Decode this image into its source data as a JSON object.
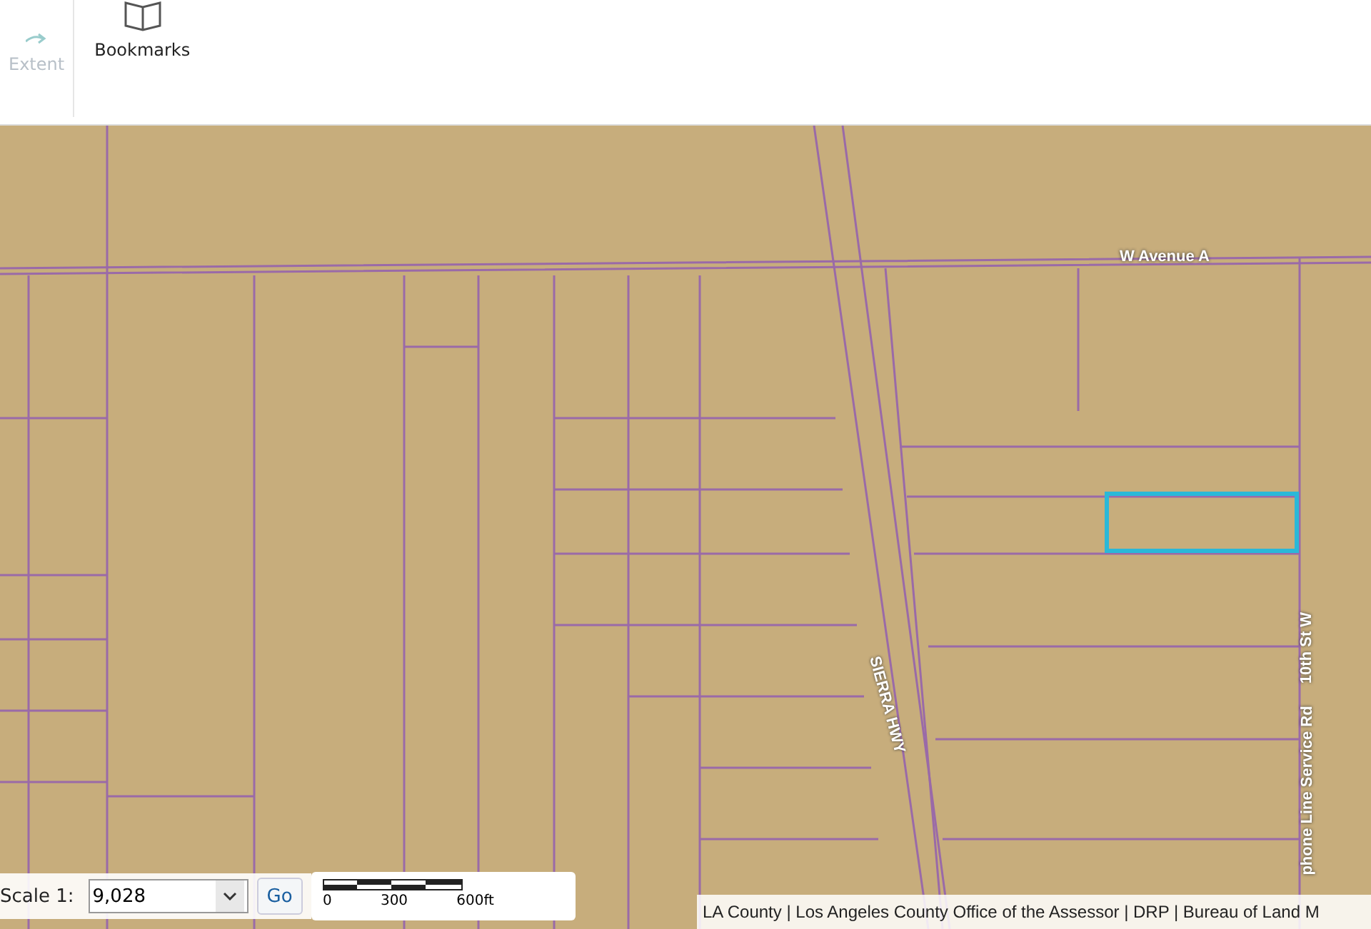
{
  "toolbar": {
    "items": [
      {
        "label": "Extent",
        "disabled": true
      },
      {
        "label": "Bookmarks",
        "disabled": false
      }
    ]
  },
  "map": {
    "street_labels": [
      {
        "text": "W Avenue A",
        "kind": "horizontal"
      },
      {
        "text": "SIERRA HWY",
        "kind": "diagonal"
      },
      {
        "text": "10th St W",
        "kind": "vertical"
      },
      {
        "text": "phone Line Service Rd",
        "kind": "vertical"
      }
    ]
  },
  "scale_control": {
    "label": "Scale 1:",
    "value": "9,028",
    "button": "Go"
  },
  "scale_bar": {
    "ticks": [
      "0",
      "300",
      "600ft"
    ]
  },
  "attribution": "LA County | Los Angeles County Office of the Assessor | DRP | Bureau of Land M"
}
